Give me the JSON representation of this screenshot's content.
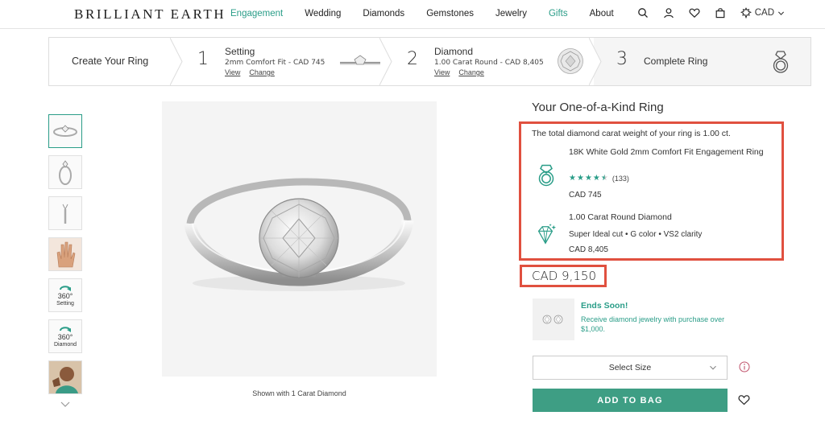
{
  "header": {
    "logo": "BRILLIANT EARTH",
    "nav": [
      {
        "label": "Engagement",
        "highlight": true
      },
      {
        "label": "Wedding",
        "highlight": false
      },
      {
        "label": "Diamonds",
        "highlight": false
      },
      {
        "label": "Gemstones",
        "highlight": false
      },
      {
        "label": "Jewelry",
        "highlight": false
      },
      {
        "label": "Gifts",
        "highlight": true
      },
      {
        "label": "About",
        "highlight": false
      }
    ],
    "icons": [
      "search-icon",
      "account-icon",
      "wishlist-icon",
      "bag-icon",
      "currency-flag-icon"
    ],
    "currency": "CAD"
  },
  "builder": {
    "create_label": "Create Your Ring",
    "steps": [
      {
        "num": "1",
        "title": "Setting",
        "sub": "2mm Comfort Fit - CAD 745",
        "view": "View",
        "change": "Change"
      },
      {
        "num": "2",
        "title": "Diamond",
        "sub": "1.00 Carat Round - CAD 8,405",
        "view": "View",
        "change": "Change"
      },
      {
        "num": "3",
        "title": "Complete Ring"
      }
    ]
  },
  "gallery": {
    "thumbs": [
      {
        "kind": "ring-angle"
      },
      {
        "kind": "ring-side"
      },
      {
        "kind": "ring-profile"
      },
      {
        "kind": "ring-hand"
      },
      {
        "kind": "360",
        "label": "360°",
        "sub": "Setting"
      },
      {
        "kind": "360",
        "label": "360°",
        "sub": "Diamond"
      },
      {
        "kind": "model"
      }
    ],
    "caption": "Shown with 1 Carat Diamond"
  },
  "product": {
    "title": "Your One-of-a-Kind Ring",
    "total_line": "The total diamond carat weight of your ring is 1.00 ct.",
    "setting": {
      "name": "18K White Gold 2mm Comfort Fit Engagement Ring",
      "rating": 4.5,
      "review_count": "(133)",
      "price": "CAD 745"
    },
    "diamond": {
      "name": "1.00 Carat Round Diamond",
      "details": "Super Ideal cut • G color • VS2 clarity",
      "price": "CAD 8,405"
    },
    "total_price": "CAD 9,150"
  },
  "promo": {
    "title": "Ends Soon!",
    "text": "Receive diamond jewelry with purchase over $1,000."
  },
  "actions": {
    "size_select": "Select Size",
    "add_to_bag": "ADD TO BAG"
  },
  "colors": {
    "accent": "#2a9d88",
    "button": "#3e9e84",
    "highlight_box": "#e0503f"
  }
}
